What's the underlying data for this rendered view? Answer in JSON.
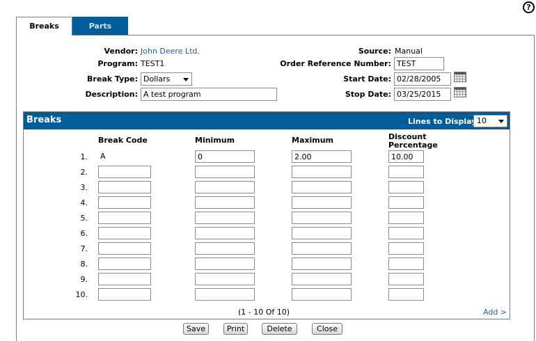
{
  "help": {
    "glyph": "?"
  },
  "tabs": [
    {
      "label": "Breaks",
      "active": true
    },
    {
      "label": "Parts",
      "active": false
    }
  ],
  "form": {
    "vendor_label": "Vendor:",
    "vendor_value": "John Deere Ltd.",
    "program_label": "Program:",
    "program_value": "TEST1",
    "break_type_label": "Break Type:",
    "break_type_value": "Dollars",
    "description_label": "Description:",
    "description_value": "A test program",
    "source_label": "Source:",
    "source_value": "Manual",
    "order_ref_label": "Order Reference Number:",
    "order_ref_value": "TEST",
    "start_date_label": "Start Date:",
    "start_date_value": "02/28/2005",
    "stop_date_label": "Stop Date:",
    "stop_date_value": "03/25/2015"
  },
  "breaks": {
    "title": "Breaks",
    "lines_label": "Lines to Display:",
    "lines_value": "10",
    "columns": {
      "break_code": "Break Code",
      "minimum": "Minimum",
      "maximum": "Maximum",
      "discount_line1": "Discount",
      "discount_line2": "Percentage"
    },
    "rows": [
      {
        "num": "1.",
        "code": "A",
        "min": "0",
        "max": "2.00",
        "disc": "10.00"
      },
      {
        "num": "2.",
        "code": "",
        "min": "",
        "max": "",
        "disc": ""
      },
      {
        "num": "3.",
        "code": "",
        "min": "",
        "max": "",
        "disc": ""
      },
      {
        "num": "4.",
        "code": "",
        "min": "",
        "max": "",
        "disc": ""
      },
      {
        "num": "5.",
        "code": "",
        "min": "",
        "max": "",
        "disc": ""
      },
      {
        "num": "6.",
        "code": "",
        "min": "",
        "max": "",
        "disc": ""
      },
      {
        "num": "7.",
        "code": "",
        "min": "",
        "max": "",
        "disc": ""
      },
      {
        "num": "8.",
        "code": "",
        "min": "",
        "max": "",
        "disc": ""
      },
      {
        "num": "9.",
        "code": "",
        "min": "",
        "max": "",
        "disc": ""
      },
      {
        "num": "10.",
        "code": "",
        "min": "",
        "max": "",
        "disc": ""
      }
    ],
    "pager": "(1  - 10 Of 10)",
    "add_label": "Add >"
  },
  "buttons": {
    "save": "Save",
    "print": "Print",
    "delete": "Delete",
    "close": "Close"
  }
}
